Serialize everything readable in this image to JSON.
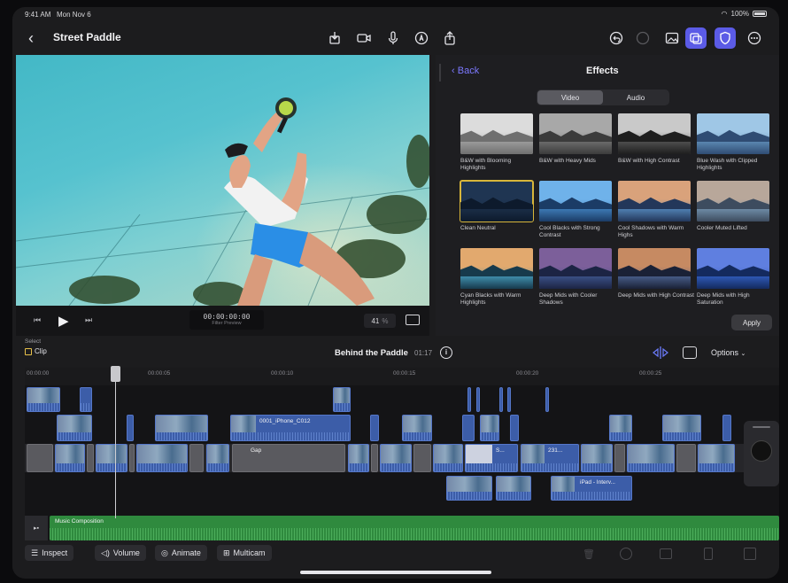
{
  "status": {
    "time": "9:41 AM",
    "date": "Mon Nov 6",
    "battery": "100%"
  },
  "topbar": {
    "title": "Street Paddle"
  },
  "viewer": {
    "timecode": "00:00:00:00",
    "timecode_caption": "Filter Preview",
    "zoom": "41",
    "zoom_unit": "%"
  },
  "effects": {
    "back_label": "Back",
    "title": "Effects",
    "tabs": [
      "Video",
      "Audio"
    ],
    "active_tab": "Video",
    "items": [
      {
        "label": "B&W with Blooming Highlights",
        "sky": "#dcdcdc",
        "mtn": "#6f6f6f",
        "water": "#9a9a9a"
      },
      {
        "label": "B&W with Heavy Mids",
        "sky": "#a8a8a8",
        "mtn": "#3b3b3b",
        "water": "#6a6a6a"
      },
      {
        "label": "B&W with High Contrast",
        "sky": "#c9c9c9",
        "mtn": "#1e1e1e",
        "water": "#4d4d4d"
      },
      {
        "label": "Blue Wash with Clipped Highlights",
        "sky": "#9fc7e6",
        "mtn": "#2f4c73",
        "water": "#5a86b0"
      },
      {
        "label": "Clean Neutral",
        "sky": "#1f3552",
        "mtn": "#0d1a2c",
        "water": "#1a2d46",
        "selected": true
      },
      {
        "label": "Cool Blacks with Strong Contrast",
        "sky": "#6fb2ea",
        "mtn": "#1b3c66",
        "water": "#3c78b3"
      },
      {
        "label": "Cool Shadows with Warm Highs",
        "sky": "#d9a27b",
        "mtn": "#23375a",
        "water": "#4f7fb0"
      },
      {
        "label": "Cooler Muted Lifted",
        "sky": "#b8a79a",
        "mtn": "#3d4c5f",
        "water": "#6d8aa5"
      },
      {
        "label": "Cyan Blacks with Warm Highlights",
        "sky": "#e2a96e",
        "mtn": "#173a4c",
        "water": "#3f8caa"
      },
      {
        "label": "Deep Mids with Cooler Shadows",
        "sky": "#7c5f9a",
        "mtn": "#1c2444",
        "water": "#3a4f84"
      },
      {
        "label": "Deep Mids with High Contrast",
        "sky": "#c68a62",
        "mtn": "#1a2136",
        "water": "#465b86"
      },
      {
        "label": "Deep Mids with High Saturation",
        "sky": "#5f7fe0",
        "mtn": "#142a5e",
        "water": "#2e58b4"
      }
    ],
    "apply_label": "Apply"
  },
  "timeline": {
    "select_label": "Select",
    "clip_label": "Clip",
    "project_name": "Behind the Paddle",
    "duration": "01:17",
    "options_label": "Options",
    "ruler": [
      "00:00:00",
      "00:00:05",
      "00:00:10",
      "00:00:15",
      "00:00:20",
      "00:00:25"
    ],
    "clips": {
      "iphone": "0001_iPhone_C012",
      "gap": "Gap",
      "ipad": "iPad - Interv...",
      "num231": "231...",
      "short_s": "S..."
    },
    "music_label": "Music Composition"
  },
  "bottombar": {
    "inspect": "Inspect",
    "volume": "Volume",
    "animate": "Animate",
    "multicam": "Multicam"
  },
  "colors": {
    "accent": "#5b5be6",
    "clip_blue": "#3c5da8",
    "audio_green": "#2f8a3e",
    "selection": "#d8b63a"
  }
}
